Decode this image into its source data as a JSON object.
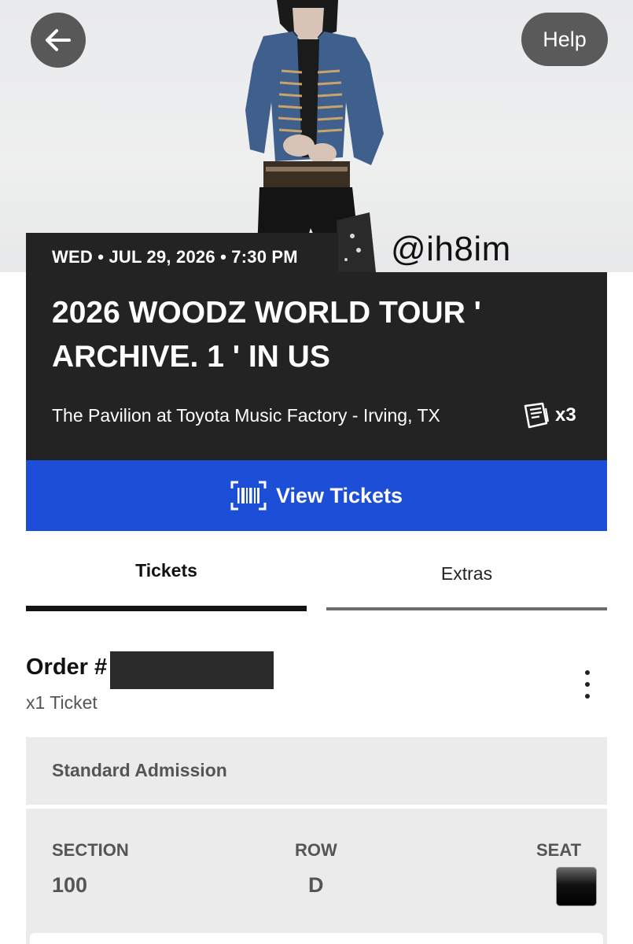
{
  "header": {
    "help_label": "Help",
    "watermark": "@ih8im"
  },
  "event": {
    "date_line": "WED • JUL 29, 2026 • 7:30 PM",
    "title": "2026 WOODZ WORLD TOUR ' ARCHIVE. 1 ' IN US",
    "venue": "The Pavilion at Toyota Music Factory - Irving, TX",
    "ticket_count": "x3"
  },
  "actions": {
    "view_tickets_label": "View Tickets"
  },
  "tabs": [
    {
      "label": "Tickets",
      "active": true
    },
    {
      "label": "Extras",
      "active": false
    }
  ],
  "order": {
    "label": "Order #",
    "ticket_qty": "x1 Ticket"
  },
  "ticket": {
    "admission": "Standard Admission",
    "section_label": "SECTION",
    "section_value": "100",
    "row_label": "ROW",
    "row_value": "D",
    "seat_label": "SEAT"
  },
  "colors": {
    "card_bg": "#232323",
    "accent_blue": "#1d4ed8",
    "panel_gray": "#ebebeb"
  }
}
